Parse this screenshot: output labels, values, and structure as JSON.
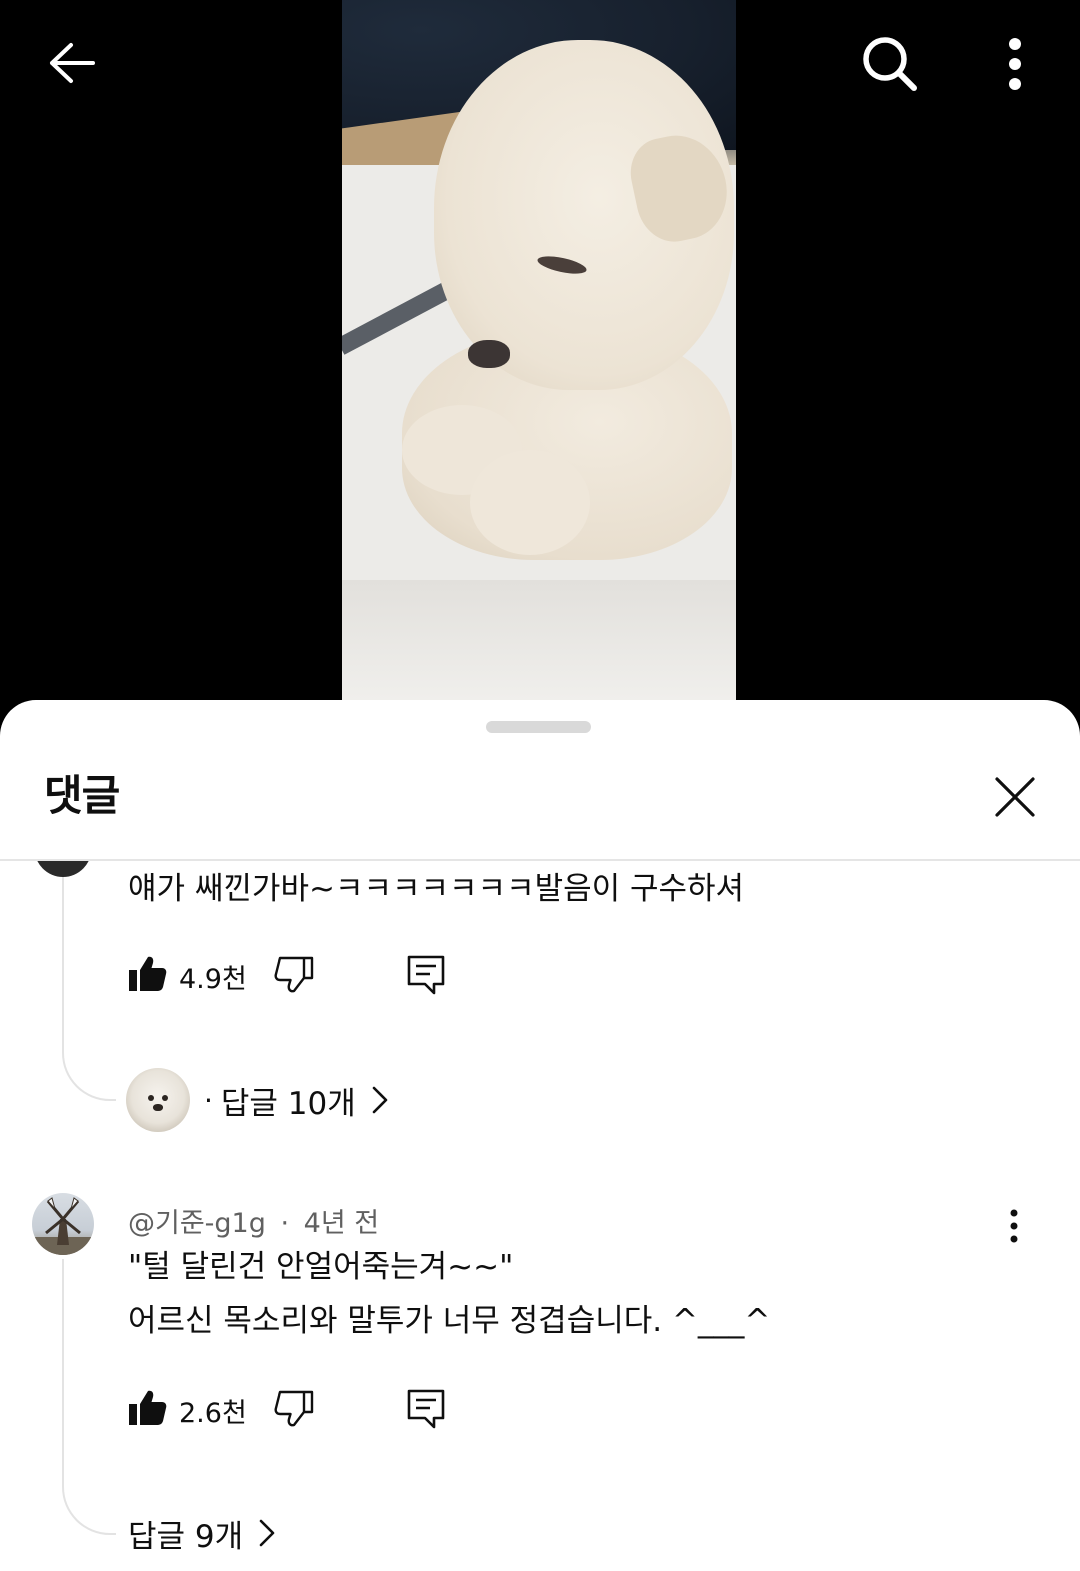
{
  "video": {
    "back_icon": "arrow-left-icon",
    "search_icon": "search-icon",
    "more_icon": "more-vertical-icon"
  },
  "sheet": {
    "title": "댓글",
    "close_icon": "close-icon"
  },
  "comments": [
    {
      "text": "얘가 쌔낀가바~ㅋㅋㅋㅋㅋㅋㅋ발음이 구수하셔",
      "likes": "4.9천",
      "reply_count_label": "답글 10개",
      "reply_dot": "·"
    },
    {
      "author": "@기준-g1g",
      "time": "4년 전",
      "separator": "·",
      "lines": [
        "\"털 달린건 안얼어죽는겨~~\"",
        "어르신 목소리와 말투가 너무 정겹습니다. ^___^"
      ],
      "likes": "2.6천",
      "reply_count_label": "답글 9개"
    }
  ],
  "colors": {
    "background_video": "#000000",
    "sheet": "#ffffff",
    "text_primary": "#0f0f0f",
    "text_secondary": "#606060",
    "thread_line": "#e3e3e3"
  }
}
